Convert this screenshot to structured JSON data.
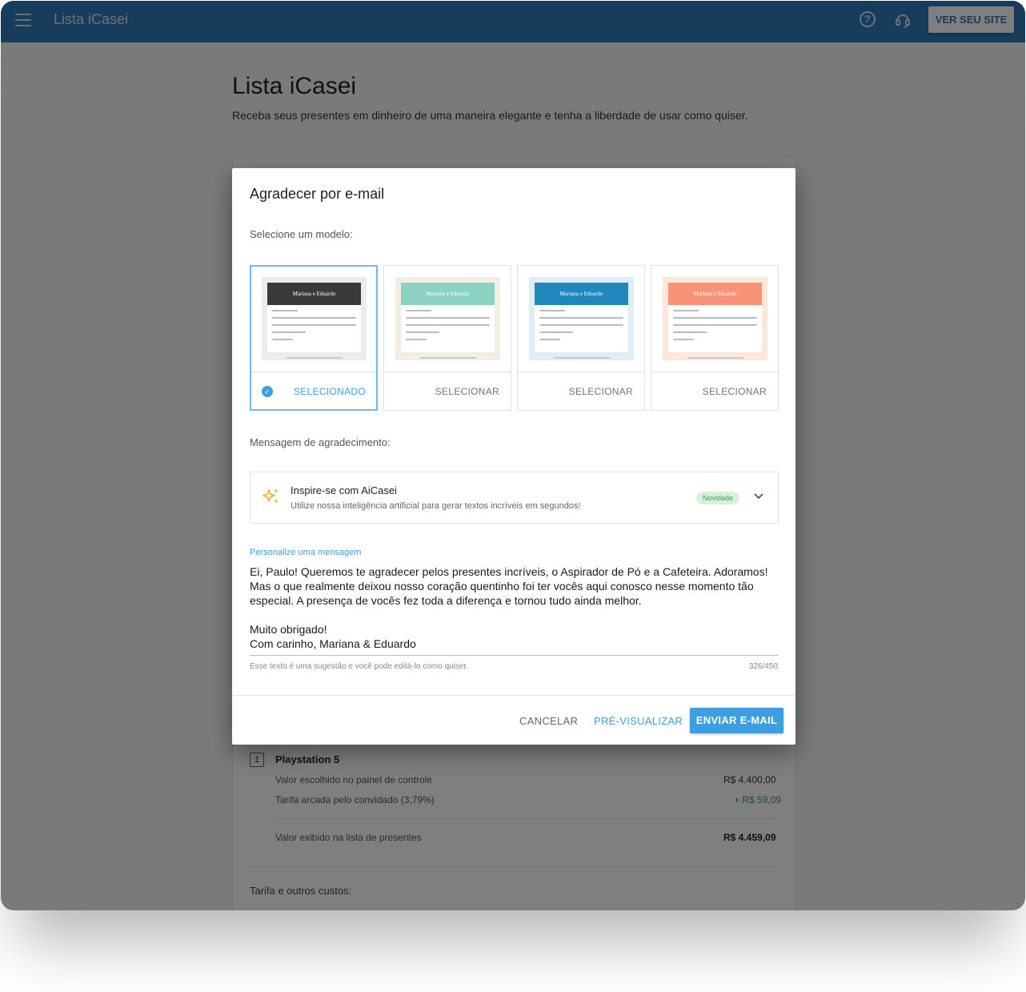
{
  "app": {
    "title": "Lista iCasei",
    "site_button": "VER SEU SITE",
    "menu_icon": "menu-icon",
    "help_icon": "help-icon",
    "support_icon": "headset-icon"
  },
  "page": {
    "title": "Lista iCasei",
    "subtitle": "Receba seus presentes em dinheiro de uma maneira elegante e tenha a liberdade de usar como quiser."
  },
  "background_item": {
    "quantity": "1",
    "name": "Playstation 5",
    "rows": [
      {
        "label": "Valor escolhido no painel de controle",
        "value": "R$ 4.400,00"
      },
      {
        "label": "Tarifa arcada pelo convidado (3,79%)",
        "value": "+ R$ 59,09"
      }
    ],
    "total_label": "Valor exibido na lista de presentes",
    "total_value": "R$ 4.459,09",
    "next_section": "Tarifa e outros custos:"
  },
  "dialog": {
    "title": "Agradecer por e-mail",
    "template_label": "Selecione um modelo:",
    "templates": [
      {
        "name": "Mariana e Eduardo",
        "button": "SELECIONADO",
        "selected": true,
        "header_color": "#3a3a3a",
        "bg_color": "#ececec"
      },
      {
        "name": "Mariana e Eduardo",
        "button": "SELECIONAR",
        "selected": false,
        "header_color": "#8ad3c3",
        "bg_color": "#f4ede3"
      },
      {
        "name": "Mariana e Eduardo",
        "button": "SELECIONAR",
        "selected": false,
        "header_color": "#2188bd",
        "bg_color": "#dfedf4"
      },
      {
        "name": "Mariana e Eduardo",
        "button": "SELECIONAR",
        "selected": false,
        "header_color": "#f99378",
        "bg_color": "#fde6da"
      }
    ],
    "message_label": "Mensagem de agradecimento:",
    "ai": {
      "title": "Inspire-se com AiCasei",
      "subtitle": "Utilize nossa inteligência artificial para gerar textos incríveis em segundos!",
      "badge": "Novidade",
      "icon": "sparkle-icon",
      "expand_icon": "chevron-down-icon"
    },
    "field_label": "Personalize uma mensagem",
    "message": "Ei, Paulo! Queremos te agradecer pelos presentes incríveis, o Aspirador de Pó e a Cafeteira. Adoramos! Mas o que realmente deixou nosso coração quentinho foi ter vocês aqui conosco nesse momento tão especial. A presença de vocês fez toda a diferença e tornou tudo ainda melhor.\n\nMuito obrigado!\nCom carinho, Mariana & Eduardo",
    "helper": "Esse texto é uma sugestão e você pode editá-lo como quiser.",
    "counter": "326/450",
    "buttons": {
      "cancel": "CANCELAR",
      "preview": "PRÉ-VISUALIZAR",
      "send": "ENVIAR E-MAIL"
    }
  },
  "colors": {
    "brand_blue": "#2f79b9",
    "accent": "#3d9ee0",
    "badge_green": "#3a9c4e"
  }
}
